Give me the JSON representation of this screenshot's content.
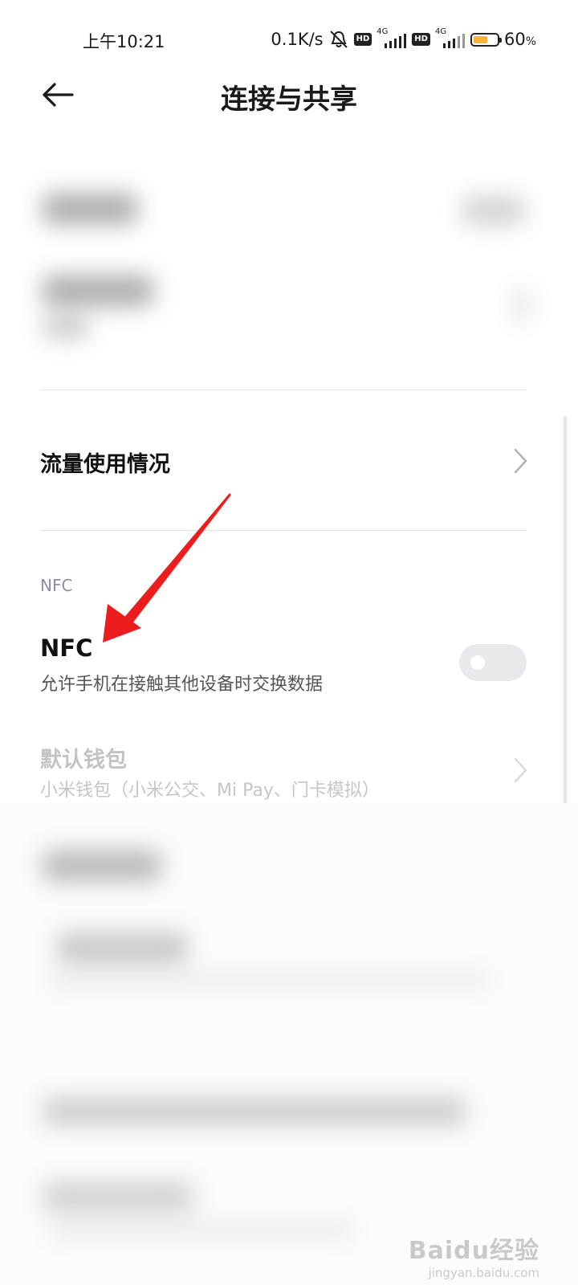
{
  "status_bar": {
    "time": "上午10:21",
    "speed": "0.1K/s",
    "hd_badge": "HD",
    "network_1": "4G",
    "network_2": "4G",
    "battery_percent": "60",
    "battery_percent_sign": "%",
    "battery_level": 0.6,
    "battery_color": "#f2b634"
  },
  "header": {
    "title": "连接与共享",
    "back_icon": "back-arrow-icon"
  },
  "rows": {
    "data_usage": {
      "label": "流量使用情况"
    },
    "nfc_section_label": "NFC",
    "nfc": {
      "label": "NFC",
      "description": "允许手机在接触其他设备时交换数据",
      "enabled": false
    },
    "default_wallet": {
      "label": "默认钱包",
      "description": "小米钱包（小米公交、Mi Pay、门卡模拟）",
      "enabled": false
    }
  },
  "annotation": {
    "arrow_color": "#ee1d1d"
  },
  "watermark": {
    "logo": "Baidu经验",
    "url": "jingyan.baidu.com"
  }
}
